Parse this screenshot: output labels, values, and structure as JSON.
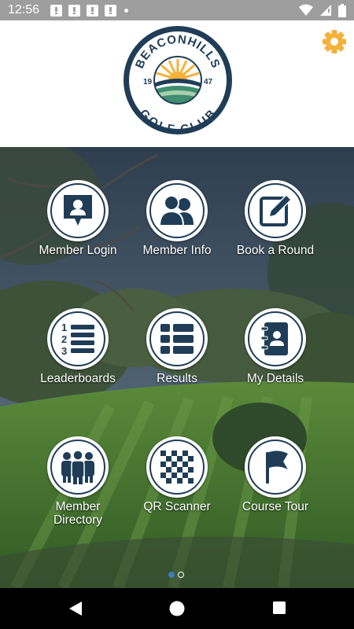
{
  "status_bar": {
    "time": "12:56"
  },
  "header": {
    "logo_text_top": "BEACONHILLS",
    "logo_text_bottom": "GOLF CLUB",
    "logo_year_left": "19",
    "logo_year_right": "47",
    "settings_icon": "gear-icon"
  },
  "colors": {
    "navy": "#1f3d57",
    "accent_orange": "#f5b23a",
    "logo_green": "#3e8e6f"
  },
  "tiles": [
    {
      "label": "Member Login",
      "icon": "member-login-icon"
    },
    {
      "label": "Member Info",
      "icon": "members-icon"
    },
    {
      "label": "Book a Round",
      "icon": "edit-icon"
    },
    {
      "label": "Leaderboards",
      "icon": "ranked-list-icon"
    },
    {
      "label": "Results",
      "icon": "list-icon"
    },
    {
      "label": "My Details",
      "icon": "contact-book-icon"
    },
    {
      "label": "Member Directory",
      "icon": "group-icon"
    },
    {
      "label": "QR Scanner",
      "icon": "checker-icon"
    },
    {
      "label": "Course Tour",
      "icon": "flag-icon"
    }
  ],
  "pager": {
    "pages": 2,
    "current": 1
  }
}
